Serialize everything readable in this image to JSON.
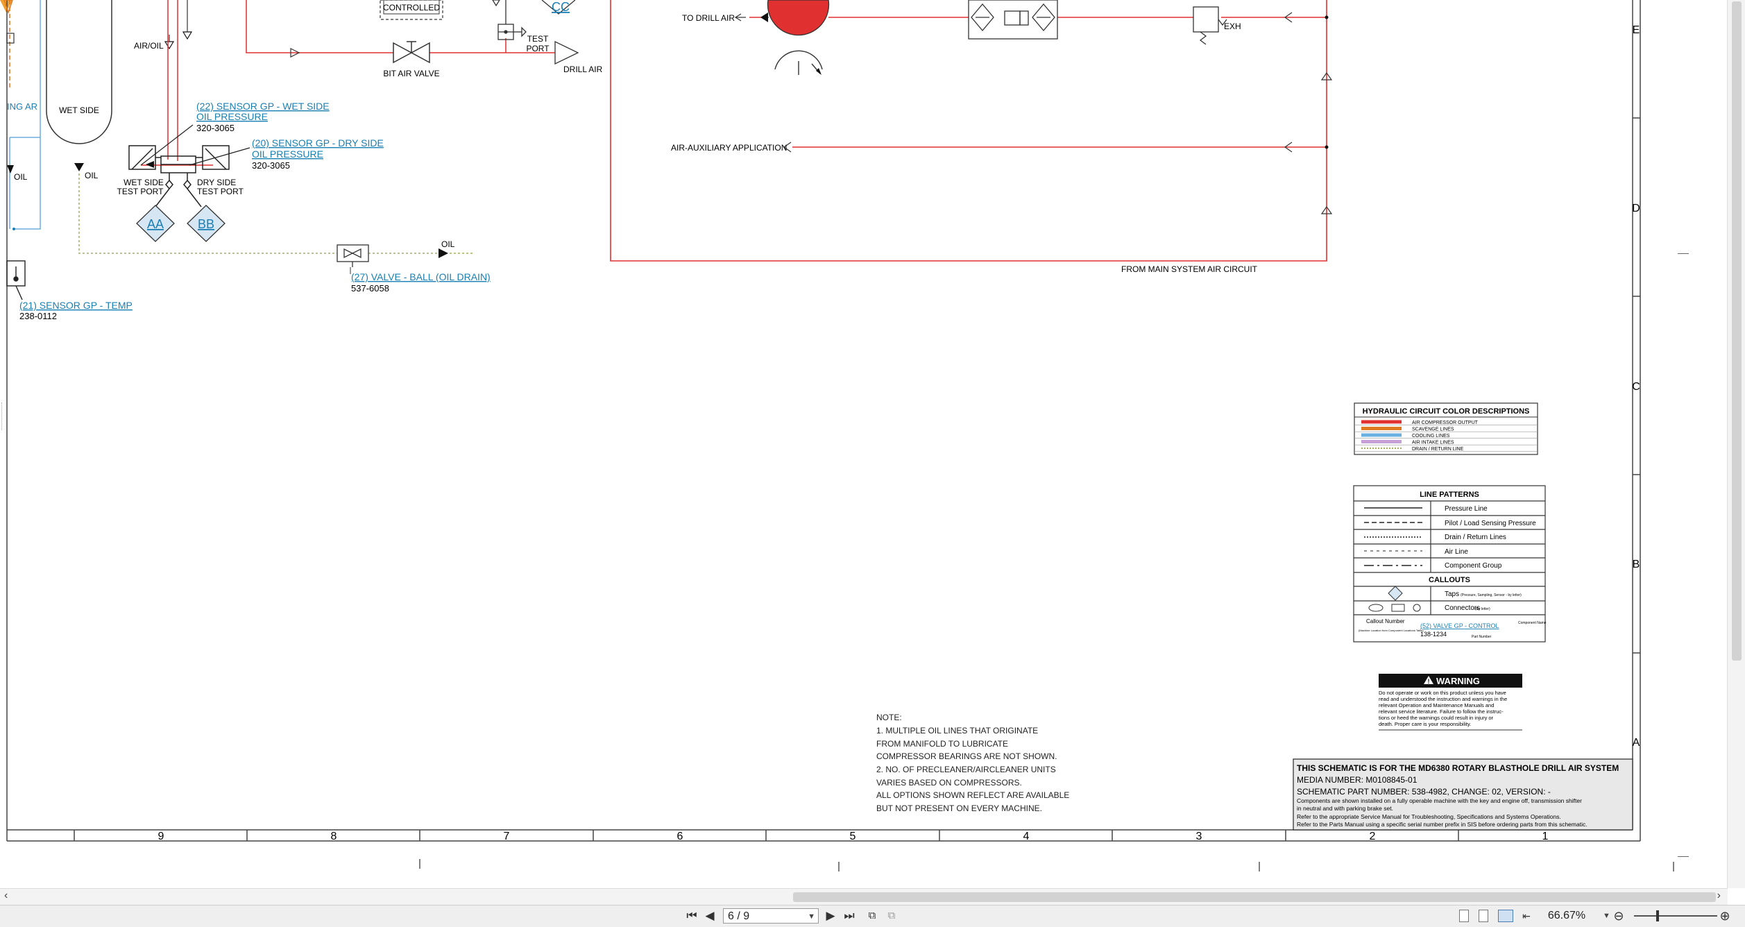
{
  "schematic": {
    "labels": {
      "air_oil": "AIR/OIL",
      "wet_side": "WET SIDE",
      "oil_left": "OIL",
      "oil_mid": "OIL",
      "oil_right": "OIL",
      "ing_air": "ING AR",
      "controlled": "CONTROLLED",
      "cc": "CC",
      "test_port_1": "TEST",
      "test_port_2": "PORT",
      "bit_air_valve": "BIT AIR VALVE",
      "drill_air": "DRILL AIR",
      "to_drill_air": "TO DRILL AIR",
      "exh": "EXH",
      "air_aux": "AIR-AUXILIARY APPLICATION",
      "from_main": "FROM MAIN SYSTEM AIR CIRCUIT",
      "wet_side_test_1": "WET SIDE",
      "wet_side_test_2": "TEST PORT",
      "dry_side_test_1": "DRY SIDE",
      "dry_side_test_2": "TEST PORT",
      "aa": "AA",
      "bb": "BB"
    },
    "callouts": {
      "c22_line1": "(22) SENSOR GP - WET SIDE",
      "c22_line2": "OIL PRESSURE",
      "c22_part": "320-3065",
      "c20_line1": "(20) SENSOR GP - DRY SIDE",
      "c20_line2": "OIL PRESSURE",
      "c20_part": "320-3065",
      "c27_line1": "(27) VALVE - BALL (OIL DRAIN)",
      "c27_part": "537-6058",
      "c21_line1": "(21) SENSOR GP - TEMP",
      "c21_part": "238-0112"
    },
    "border": {
      "row_letters": [
        "E",
        "D",
        "C",
        "B",
        "A"
      ],
      "col_numbers": [
        "9",
        "8",
        "7",
        "6",
        "5",
        "4",
        "3",
        "2",
        "1"
      ]
    },
    "notes": {
      "title": "NOTE:",
      "lines": [
        "1. MULTIPLE OIL LINES THAT ORIGINATE",
        "FROM MANIFOLD TO LUBRICATE",
        "COMPRESSOR BEARINGS ARE NOT SHOWN.",
        "2. NO. OF PRECLEANER/AIRCLEANER UNITS",
        "VARIES BASED ON COMPRESSORS.",
        "ALL OPTIONS SHOWN REFLECT ARE AVAILABLE",
        "BUT NOT PRESENT ON EVERY MACHINE."
      ]
    },
    "color_legend": {
      "title": "HYDRAULIC CIRCUIT COLOR DESCRIPTIONS",
      "items": [
        {
          "label": "AIR COMPRESSOR OUTPUT",
          "color": "#e03030"
        },
        {
          "label": "SCAVENGE LINES",
          "color": "#e07a20"
        },
        {
          "label": "COOLING LINES",
          "color": "#6ab0e0"
        },
        {
          "label": "AIR INTAKE LINES",
          "color": "#c8a0d8"
        },
        {
          "label": "DRAIN / RETURN LINE",
          "color": "#a8b060"
        }
      ]
    },
    "line_patterns": {
      "title": "LINE PATTERNS",
      "items": [
        {
          "label": "Pressure Line"
        },
        {
          "label": "Pilot / Load Sensing Pressure"
        },
        {
          "label": "Drain / Return Lines"
        },
        {
          "label": "Air Line"
        },
        {
          "label": "Component Group"
        }
      ],
      "callouts_title": "CALLOUTS",
      "taps_label": "Taps",
      "taps_note": "(Pressure, Sampling, Sensor - by letter)",
      "connectors_label": "Connectors",
      "connectors_note": "(By letter)",
      "example_callout_number": "Callout Number",
      "example_callout_note": "(Machine Location from Component Locations Table)",
      "example_callout": "(52) VALVE GP - CONTROL",
      "example_component": "Component Name",
      "example_part": "138-1234",
      "example_part_label": "Part Number"
    },
    "warning": {
      "title": "WARNING",
      "text": [
        "Do not operate or work on this product unless you have",
        "read and understood the instruction and warnings in the",
        "relevant Operation and Maintenance Manuals and",
        "relevant service literature. Failure to follow the instruc-",
        "tions or heed the warnings could result in injury or",
        "death. Proper care is your responsibility."
      ]
    },
    "title_block": {
      "heading": "THIS SCHEMATIC IS FOR THE MD6380 ROTARY BLASTHOLE DRILL AIR SYSTEM",
      "media": "MEDIA NUMBER: M0108845-01",
      "part": "SCHEMATIC PART NUMBER: 538-4982, CHANGE: 02, VERSION: -",
      "line1": "Components are shown installed on a fully operable machine with the key and engine off, transmission shifter",
      "line2": "in neutral and with parking brake set.",
      "line3": "Refer to the appropriate Service Manual for Troubleshooting, Specifications and Systems Operations.",
      "line4": "Refer to the Parts Manual using a specific serial number prefix in SIS before ordering parts from this schematic."
    }
  },
  "toolbar": {
    "first_page": "first-page-icon",
    "prev_page": "previous-page-icon",
    "page_value": "6 / 9",
    "next_page": "next-page-icon",
    "last_page": "last-page-icon",
    "zoom_value": "66.67%"
  }
}
